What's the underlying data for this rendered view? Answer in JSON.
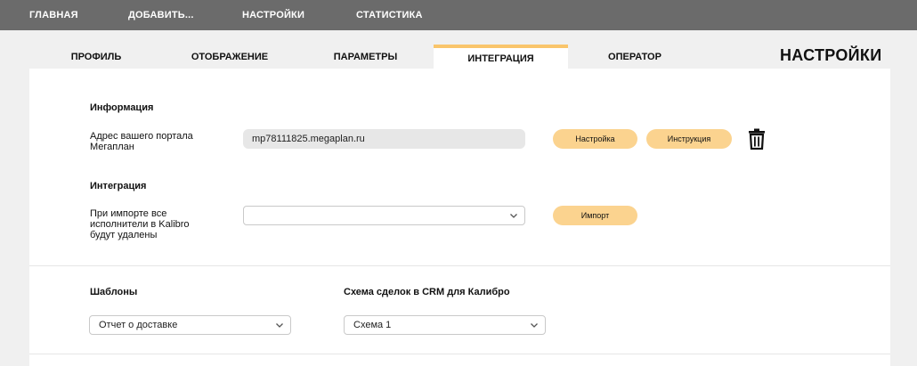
{
  "topnav": {
    "items": [
      "ГЛАВНАЯ",
      "ДОБАВИТЬ...",
      "НАСТРОЙКИ",
      "СТАТИСТИКА"
    ]
  },
  "tabs": {
    "items": [
      "ПРОФИЛЬ",
      "ОТОБРАЖЕНИЕ",
      "ПАРАМЕТРЫ",
      "ИНТЕГРАЦИЯ",
      "ОПЕРАТОР"
    ],
    "active": "ИНТЕГРАЦИЯ"
  },
  "page_title": "НАСТРОЙКИ",
  "info": {
    "title": "Информация",
    "portal_label_line1": "Адрес вашего портала",
    "portal_label_line2": "Мегаплан",
    "portal_value": "mp78111825.megaplan.ru",
    "setup_button": "Настройка",
    "instruction_button": "Инструкция"
  },
  "integration": {
    "title": "Интеграция",
    "note_line1": "При импорте все",
    "note_line2": "исполнители в Kalibro",
    "note_line3": "будут удалены",
    "select_value": "",
    "import_button": "Импорт"
  },
  "templates": {
    "title": "Шаблоны",
    "select_value": "Отчет о доставке"
  },
  "crm_scheme": {
    "title": "Схема сделок в CRM для Калибро",
    "select_value": "Схема 1"
  },
  "colors": {
    "topnav_bg": "#6b6b6b",
    "accent": "#f9c56b",
    "button_bg": "#fbd38f",
    "page_bg": "#f0f0f0"
  },
  "icons": {
    "delete": "trash-icon",
    "dropdown": "chevron-down-icon"
  }
}
